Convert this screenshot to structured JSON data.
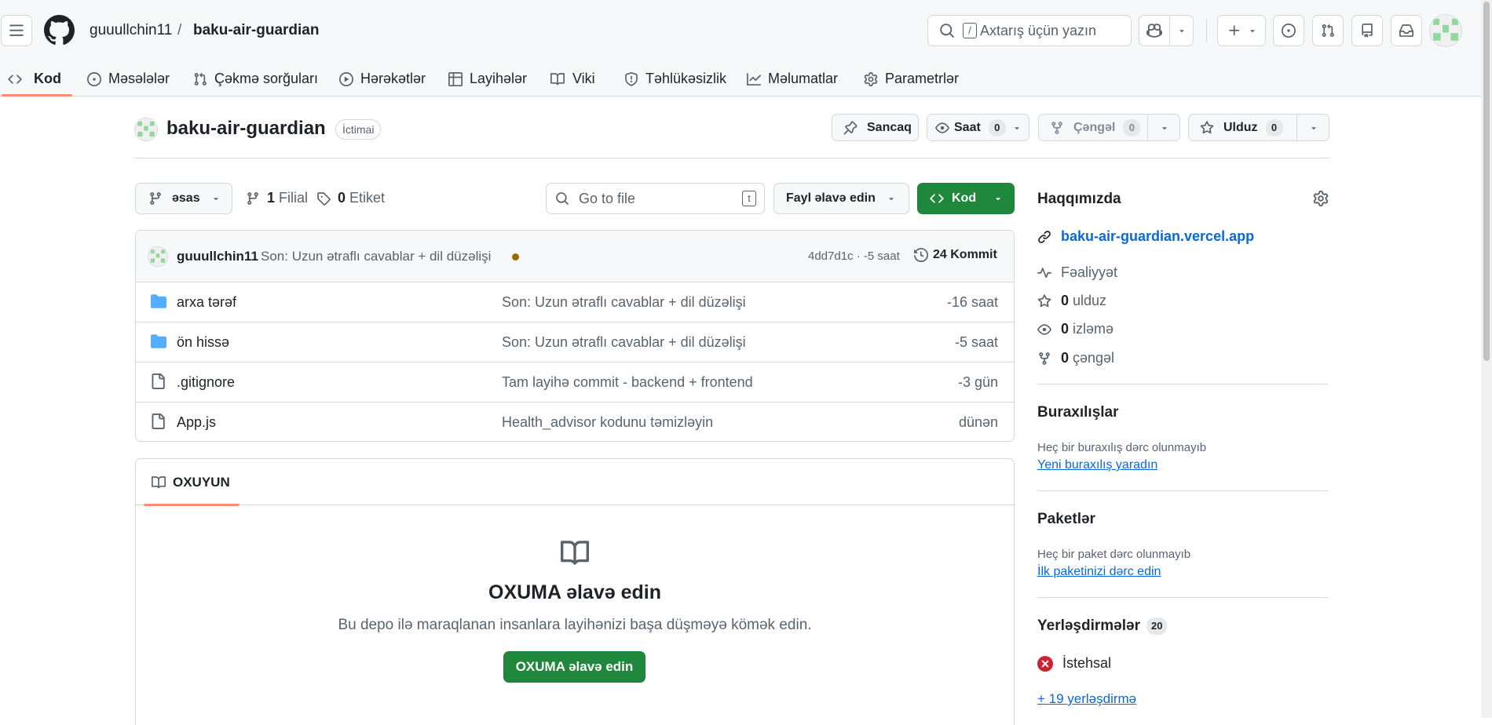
{
  "header": {
    "owner": "guuullchin11",
    "slash": "/",
    "repo": "baku-air-guardian",
    "search_placeholder": "Axtarış üçün yazın",
    "search_key": "/"
  },
  "tabs": [
    {
      "label": "Kod",
      "icon": "code-icon",
      "active": true
    },
    {
      "label": "Məsələlər",
      "icon": "issue-icon"
    },
    {
      "label": "Çəkmə sorğuları",
      "icon": "pull-request-icon"
    },
    {
      "label": "Hərəkətlər",
      "icon": "play-icon"
    },
    {
      "label": "Layihələr",
      "icon": "table-icon"
    },
    {
      "label": "Viki",
      "icon": "book-icon"
    },
    {
      "label": "Təhlükəsizlik",
      "icon": "shield-icon"
    },
    {
      "label": "Məlumatlar",
      "icon": "graph-icon"
    },
    {
      "label": "Parametrlər",
      "icon": "gear-icon"
    }
  ],
  "repo_head": {
    "name": "baku-air-guardian",
    "visibility": "İctimai",
    "pin_label": "Sancaq",
    "watch_label": "Saat",
    "watch_count": "0",
    "fork_label": "Çəngəl",
    "fork_count": "0",
    "star_label": "Ulduz",
    "star_count": "0"
  },
  "toolbar": {
    "branch": "əsas",
    "branch_count": "1",
    "branch_label": "Filial",
    "tag_count": "0",
    "tag_label": "Etiket",
    "goto_placeholder": "Go to file",
    "goto_key": "t",
    "add_file": "Fayl əlavə edin",
    "code_btn": "Kod"
  },
  "commit": {
    "author": "guuullchin11",
    "message": "Son: Uzun ətraflı cavablar + dil düzəlişi",
    "hash": "4dd7d1c · -5 saat",
    "count_label": "24 Kommit"
  },
  "files": [
    {
      "name": "arxa tərəf",
      "type": "folder",
      "msg": "Son: Uzun ətraflı cavablar + dil düzəlişi",
      "time": "-16 saat"
    },
    {
      "name": "ön hissə",
      "type": "folder",
      "msg": "Son: Uzun ətraflı cavablar + dil düzəlişi",
      "time": "-5 saat"
    },
    {
      "name": ".gitignore",
      "type": "file",
      "msg": "Tam layihə commit - backend + frontend",
      "time": "-3 gün"
    },
    {
      "name": "App.js",
      "type": "file",
      "msg": "Health_advisor kodunu təmizləyin",
      "time": "dünən"
    }
  ],
  "readme": {
    "tab": "OXUYUN",
    "title": "OXUMA əlavə edin",
    "desc": "Bu depo ilə maraqlanan insanlara layihənizi başa düşməyə kömək edin.",
    "button": "OXUMA əlavə edin"
  },
  "about": {
    "title": "Haqqımızda",
    "link": "baku-air-guardian.vercel.app",
    "activity": "Fəaliyyət",
    "stars_n": "0",
    "stars_l": "ulduz",
    "watch_n": "0",
    "watch_l": "izləmə",
    "fork_n": "0",
    "fork_l": "çəngəl"
  },
  "releases": {
    "title": "Buraxılışlar",
    "empty": "Heç bir buraxılış dərc olunmayıb",
    "link": "Yeni buraxılış yaradın"
  },
  "packages": {
    "title": "Paketlər",
    "empty": "Heç bir paket dərc olunmayıb",
    "link": "İlk paketinizi dərc edin"
  },
  "deployments": {
    "title": "Yerləşdirmələr",
    "count": "20",
    "env": "İstehsal",
    "more": "+ 19 yerləşdirmə"
  },
  "colors": {
    "green": "#1f883d",
    "link": "#0969da",
    "error": "#cf222e",
    "folder": "#54aeff"
  }
}
